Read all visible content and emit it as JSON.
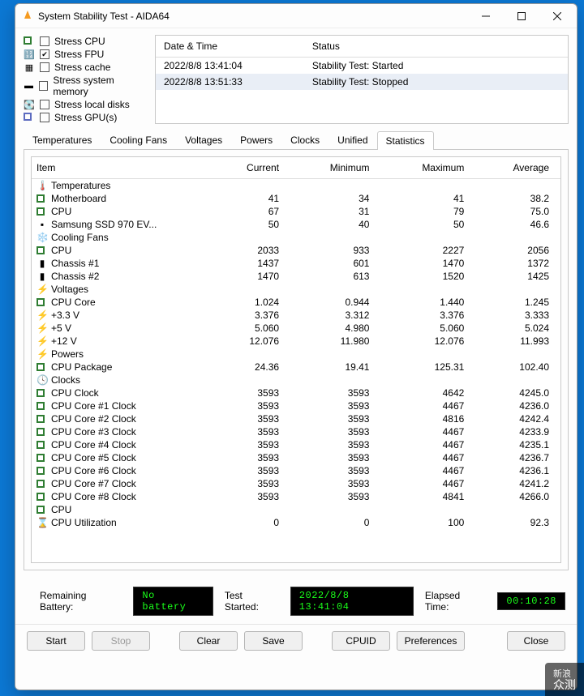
{
  "window": {
    "title": "System Stability Test - AIDA64"
  },
  "options": {
    "cpu": {
      "label": "Stress CPU",
      "checked": false
    },
    "fpu": {
      "label": "Stress FPU",
      "checked": true
    },
    "cache": {
      "label": "Stress cache",
      "checked": false
    },
    "mem": {
      "label": "Stress system memory",
      "checked": false
    },
    "disk": {
      "label": "Stress local disks",
      "checked": false
    },
    "gpu": {
      "label": "Stress GPU(s)",
      "checked": false
    }
  },
  "log": {
    "head_date": "Date & Time",
    "head_status": "Status",
    "rows": [
      {
        "dt": "2022/8/8 13:41:04",
        "status": "Stability Test: Started"
      },
      {
        "dt": "2022/8/8 13:51:33",
        "status": "Stability Test: Stopped"
      }
    ]
  },
  "tabs": {
    "temperatures": "Temperatures",
    "cooling": "Cooling Fans",
    "voltages": "Voltages",
    "powers": "Powers",
    "clocks": "Clocks",
    "unified": "Unified",
    "statistics": "Statistics"
  },
  "stats": {
    "head": {
      "item": "Item",
      "cur": "Current",
      "min": "Minimum",
      "max": "Maximum",
      "avg": "Average"
    },
    "temps_label": "Temperatures",
    "temps": [
      {
        "name": "Motherboard",
        "cur": "41",
        "min": "34",
        "max": "41",
        "avg": "38.2"
      },
      {
        "name": "CPU",
        "cur": "67",
        "min": "31",
        "max": "79",
        "avg": "75.0"
      },
      {
        "name": "Samsung SSD 970 EV...",
        "cur": "50",
        "min": "40",
        "max": "50",
        "avg": "46.6"
      }
    ],
    "fans_label": "Cooling Fans",
    "fans": [
      {
        "name": "CPU",
        "cur": "2033",
        "min": "933",
        "max": "2227",
        "avg": "2056"
      },
      {
        "name": "Chassis #1",
        "cur": "1437",
        "min": "601",
        "max": "1470",
        "avg": "1372"
      },
      {
        "name": "Chassis #2",
        "cur": "1470",
        "min": "613",
        "max": "1520",
        "avg": "1425"
      }
    ],
    "volts_label": "Voltages",
    "volts": [
      {
        "name": "CPU Core",
        "cur": "1.024",
        "min": "0.944",
        "max": "1.440",
        "avg": "1.245"
      },
      {
        "name": "+3.3 V",
        "cur": "3.376",
        "min": "3.312",
        "max": "3.376",
        "avg": "3.333"
      },
      {
        "name": "+5 V",
        "cur": "5.060",
        "min": "4.980",
        "max": "5.060",
        "avg": "5.024"
      },
      {
        "name": "+12 V",
        "cur": "12.076",
        "min": "11.980",
        "max": "12.076",
        "avg": "11.993"
      }
    ],
    "powers_label": "Powers",
    "powers": [
      {
        "name": "CPU Package",
        "cur": "24.36",
        "min": "19.41",
        "max": "125.31",
        "avg": "102.40"
      }
    ],
    "clocks_label": "Clocks",
    "clocks": [
      {
        "name": "CPU Clock",
        "cur": "3593",
        "min": "3593",
        "max": "4642",
        "avg": "4245.0"
      },
      {
        "name": "CPU Core #1 Clock",
        "cur": "3593",
        "min": "3593",
        "max": "4467",
        "avg": "4236.0"
      },
      {
        "name": "CPU Core #2 Clock",
        "cur": "3593",
        "min": "3593",
        "max": "4816",
        "avg": "4242.4"
      },
      {
        "name": "CPU Core #3 Clock",
        "cur": "3593",
        "min": "3593",
        "max": "4467",
        "avg": "4233.9"
      },
      {
        "name": "CPU Core #4 Clock",
        "cur": "3593",
        "min": "3593",
        "max": "4467",
        "avg": "4235.1"
      },
      {
        "name": "CPU Core #5 Clock",
        "cur": "3593",
        "min": "3593",
        "max": "4467",
        "avg": "4236.7"
      },
      {
        "name": "CPU Core #6 Clock",
        "cur": "3593",
        "min": "3593",
        "max": "4467",
        "avg": "4236.1"
      },
      {
        "name": "CPU Core #7 Clock",
        "cur": "3593",
        "min": "3593",
        "max": "4467",
        "avg": "4241.2"
      },
      {
        "name": "CPU Core #8 Clock",
        "cur": "3593",
        "min": "3593",
        "max": "4841",
        "avg": "4266.0"
      }
    ],
    "cpu_label": "CPU",
    "cpu": [
      {
        "name": "CPU Utilization",
        "cur": "0",
        "min": "0",
        "max": "100",
        "avg": "92.3"
      }
    ]
  },
  "statusbar": {
    "battery_label": "Remaining Battery:",
    "battery_value": "No battery",
    "started_label": "Test Started:",
    "started_value": "2022/8/8 13:41:04",
    "elapsed_label": "Elapsed Time:",
    "elapsed_value": "00:10:28"
  },
  "buttons": {
    "start": "Start",
    "stop": "Stop",
    "clear": "Clear",
    "save": "Save",
    "cpuid": "CPUID",
    "prefs": "Preferences",
    "close": "Close"
  },
  "watermark": {
    "top": "新浪",
    "bottom": "众测"
  }
}
